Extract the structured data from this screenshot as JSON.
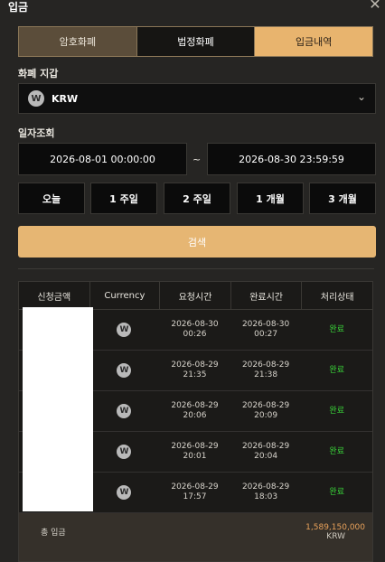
{
  "header": {
    "title": "입금",
    "close_icon": "close-icon"
  },
  "tabs": [
    {
      "label": "암호화폐"
    },
    {
      "label": "법정화폐"
    },
    {
      "label": "입금내역"
    }
  ],
  "wallet": {
    "label": "화폐 지갑",
    "selected": "KRW",
    "coin_glyph": "W"
  },
  "period": {
    "label": "일자조회",
    "start": "2026-08-01 00:00:00",
    "separator": "~",
    "end": "2026-08-30 23:59:59"
  },
  "quick": [
    "오늘",
    "1 주일",
    "2 주일",
    "1 개월",
    "3 개월"
  ],
  "search_label": "검색",
  "table": {
    "headers": [
      "신청금액",
      "Currency",
      "요청시간",
      "완료시간",
      "처리상태"
    ],
    "rows": [
      {
        "req_date": "2026-08-30",
        "req_time": "00:26",
        "done_date": "2026-08-30",
        "done_time": "00:27",
        "status": "완료"
      },
      {
        "req_date": "2026-08-29",
        "req_time": "21:35",
        "done_date": "2026-08-29",
        "done_time": "21:38",
        "status": "완료"
      },
      {
        "req_date": "2026-08-29",
        "req_time": "20:06",
        "done_date": "2026-08-29",
        "done_time": "20:09",
        "status": "완료"
      },
      {
        "req_date": "2026-08-29",
        "req_time": "20:01",
        "done_date": "2026-08-29",
        "done_time": "20:04",
        "status": "완료"
      },
      {
        "req_date": "2026-08-29",
        "req_time": "17:57",
        "done_date": "2026-08-29",
        "done_time": "18:03",
        "status": "완료"
      }
    ]
  },
  "footer": {
    "label": "총 입금",
    "amount": "1,589,150,000",
    "currency": "KRW"
  },
  "colors": {
    "accent": "#e6b673",
    "status_done": "#39d439",
    "total": "#e8a15a"
  }
}
